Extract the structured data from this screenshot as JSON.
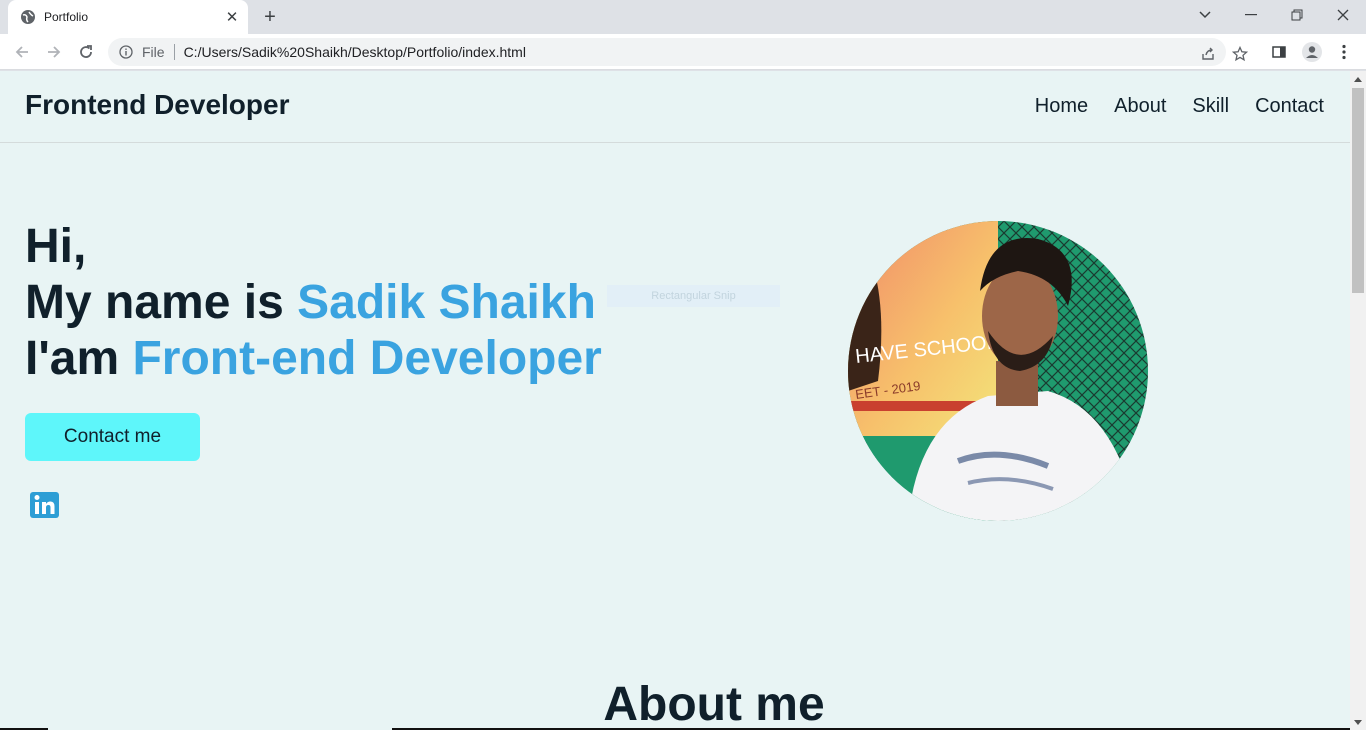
{
  "browser": {
    "tab_title": "Portfolio",
    "address_scheme": "File",
    "address_url": "C:/Users/Sadik%20Shaikh/Desktop/Portfolio/index.html"
  },
  "header": {
    "brand": "Frontend Developer",
    "nav": [
      "Home",
      "About",
      "Skill",
      "Contact"
    ]
  },
  "hero": {
    "greeting": "Hi,",
    "name_prefix": "My name is ",
    "name": "Sadik Shaikh",
    "role_prefix": "I'am ",
    "role": "Front-end Developer",
    "contact_button": "Contact me",
    "overlay_label": "Rectangular Snip"
  },
  "social": {
    "linkedin_icon": "linkedin-icon"
  },
  "about": {
    "title": "About me"
  },
  "colors": {
    "accent": "#3aa3e0",
    "button": "#5ef6fa",
    "background": "#e8f4f4",
    "text": "#10202b"
  }
}
